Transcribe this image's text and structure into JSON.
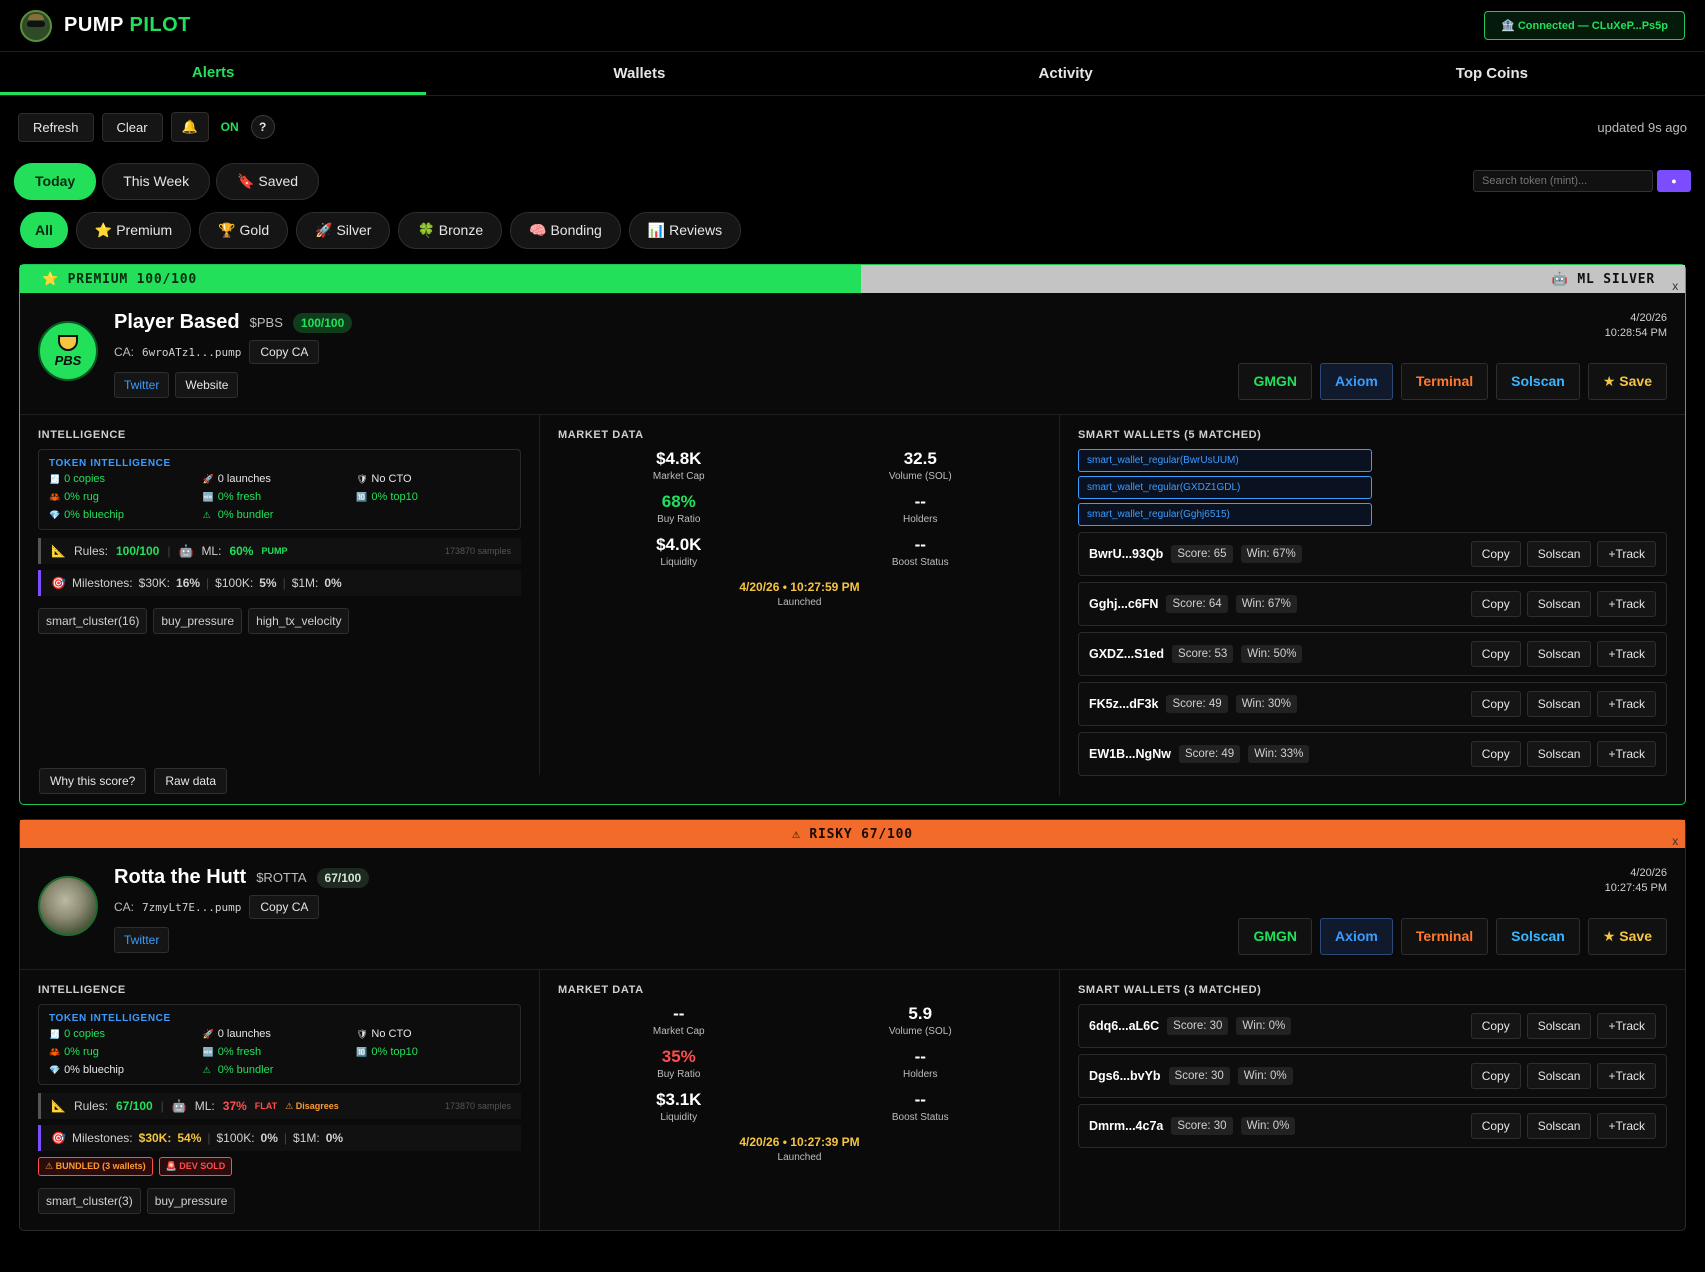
{
  "app": {
    "name_a": "PUMP",
    "name_b": "PILOT",
    "connection": "🏦 Connected — CLuXeP...Ps5p"
  },
  "nav": [
    {
      "label": "Alerts"
    },
    {
      "label": "Wallets"
    },
    {
      "label": "Activity"
    },
    {
      "label": "Top Coins"
    }
  ],
  "toolbar": {
    "refresh": "Refresh",
    "clear": "Clear",
    "bell": "🔔",
    "on": "ON",
    "help": "?",
    "updated": "updated 9s ago"
  },
  "periods": [
    {
      "label": "Today"
    },
    {
      "label": "This Week"
    },
    {
      "label": "🔖 Saved"
    }
  ],
  "search": {
    "placeholder": "Search token (mint)...",
    "go": "●"
  },
  "tiers": [
    {
      "label": "All"
    },
    {
      "label": "⭐ Premium"
    },
    {
      "label": "🏆 Gold"
    },
    {
      "label": "🚀 Silver"
    },
    {
      "label": "🍀 Bronze"
    },
    {
      "label": "🧠 Bonding"
    },
    {
      "label": "📊 Reviews"
    }
  ],
  "cards": [
    {
      "banner_left": "⭐ PREMIUM 100/100",
      "banner_right": "🤖 ML SILVER",
      "close": "x",
      "name": "Player Based",
      "ticker": "$PBS",
      "score": "100/100",
      "avatar_text": "PBS",
      "ca_label": "CA:",
      "ca": "6wroATz1...pump",
      "copy_ca": "Copy CA",
      "twitter": "Twitter",
      "website": "Website",
      "date": "4/20/26",
      "time": "10:28:54 PM",
      "ext": {
        "gmgn": "GMGN",
        "axiom": "Axiom",
        "terminal": "Terminal",
        "solscan": "Solscan",
        "save": "★ Save"
      },
      "intel_title": "INTELLIGENCE",
      "ti_title": "TOKEN INTELLIGENCE",
      "ti": [
        {
          "icon": "🧾",
          "text": "0 copies"
        },
        {
          "icon": "🚀",
          "text": "0 launches"
        },
        {
          "icon": "🛡",
          "text": "No CTO"
        },
        {
          "icon": "🦀",
          "text": "0% rug"
        },
        {
          "icon": "🆕",
          "text": "0% fresh"
        },
        {
          "icon": "🔟",
          "text": "0% top10"
        },
        {
          "icon": "💎",
          "text": "0% bluechip"
        },
        {
          "icon": "⚠",
          "text": "0% bundler"
        }
      ],
      "rules_label": "Rules:",
      "rules_val": "100/100",
      "ml_label": "ML:",
      "ml_val": "60%",
      "ml_tag": "PUMP",
      "ml_extra": "",
      "samples": "173870 samples",
      "ms_label": "Milestones:",
      "ms": [
        {
          "k": "$30K:",
          "v": "16%"
        },
        {
          "k": "$100K:",
          "v": "5%"
        },
        {
          "k": "$1M:",
          "v": "0%"
        }
      ],
      "tags": [
        "smart_cluster(16)",
        "buy_pressure",
        "high_tx_velocity"
      ],
      "md_title": "MARKET DATA",
      "md": [
        {
          "v": "$4.8K",
          "l": "Market Cap"
        },
        {
          "v": "32.5",
          "l": "Volume (SOL)"
        },
        {
          "v": "68%",
          "l": "Buy Ratio"
        },
        {
          "v": "--",
          "l": "Holders"
        },
        {
          "v": "$4.0K",
          "l": "Liquidity"
        },
        {
          "v": "--",
          "l": "Boost Status"
        }
      ],
      "launched": "4/20/26 • 10:27:59 PM",
      "launched_label": "Launched",
      "sw_title": "SMART WALLETS (5 MATCHED)",
      "sw_chips": [
        "smart_wallet_regular(BwrUsUUM)",
        "smart_wallet_regular(GXDZ1GDL)",
        "smart_wallet_regular(Gghj6515)"
      ],
      "wallets": [
        {
          "addr": "BwrU...93Qb",
          "score": "Score: 65",
          "win": "Win: 67%"
        },
        {
          "addr": "Gghj...c6FN",
          "score": "Score: 64",
          "win": "Win: 67%"
        },
        {
          "addr": "GXDZ...S1ed",
          "score": "Score: 53",
          "win": "Win: 50%"
        },
        {
          "addr": "FK5z...dF3k",
          "score": "Score: 49",
          "win": "Win: 30%"
        },
        {
          "addr": "EW1B...NgNw",
          "score": "Score: 49",
          "win": "Win: 33%"
        }
      ],
      "why": "Why this score?",
      "raw": "Raw data"
    },
    {
      "banner": "⚠ RISKY 67/100",
      "close": "x",
      "name": "Rotta the Hutt",
      "ticker": "$ROTTA",
      "score": "67/100",
      "ca_label": "CA:",
      "ca": "7zmyLt7E...pump",
      "copy_ca": "Copy CA",
      "twitter": "Twitter",
      "date": "4/20/26",
      "time": "10:27:45 PM",
      "ext": {
        "gmgn": "GMGN",
        "axiom": "Axiom",
        "terminal": "Terminal",
        "solscan": "Solscan",
        "save": "★ Save"
      },
      "intel_title": "INTELLIGENCE",
      "ti_title": "TOKEN INTELLIGENCE",
      "ti": [
        {
          "icon": "🧾",
          "text": "0 copies"
        },
        {
          "icon": "🚀",
          "text": "0 launches"
        },
        {
          "icon": "🛡",
          "text": "No CTO"
        },
        {
          "icon": "🦀",
          "text": "0% rug"
        },
        {
          "icon": "🆕",
          "text": "0% fresh"
        },
        {
          "icon": "🔟",
          "text": "0% top10"
        },
        {
          "icon": "💎",
          "text": "0% bluechip"
        },
        {
          "icon": "⚠",
          "text": "0% bundler"
        }
      ],
      "rules_label": "Rules:",
      "rules_val": "67/100",
      "ml_label": "ML:",
      "ml_val": "37%",
      "ml_tag": "FLAT",
      "ml_extra": "⚠ Disagrees",
      "samples": "173870 samples",
      "ms_label": "Milestones:",
      "ms": [
        {
          "k": "$30K:",
          "v": "54%"
        },
        {
          "k": "$100K:",
          "v": "0%"
        },
        {
          "k": "$1M:",
          "v": "0%"
        }
      ],
      "warns": [
        "⚠ BUNDLED (3 wallets)",
        "🚨 DEV SOLD"
      ],
      "tags": [
        "smart_cluster(3)",
        "buy_pressure"
      ],
      "md_title": "MARKET DATA",
      "md": [
        {
          "v": "--",
          "l": "Market Cap"
        },
        {
          "v": "5.9",
          "l": "Volume (SOL)"
        },
        {
          "v": "35%",
          "l": "Buy Ratio"
        },
        {
          "v": "--",
          "l": "Holders"
        },
        {
          "v": "$3.1K",
          "l": "Liquidity"
        },
        {
          "v": "--",
          "l": "Boost Status"
        }
      ],
      "launched": "4/20/26 • 10:27:39 PM",
      "launched_label": "Launched",
      "sw_title": "SMART WALLETS (3 MATCHED)",
      "wallets": [
        {
          "addr": "6dq6...aL6C",
          "score": "Score: 30",
          "win": "Win: 0%"
        },
        {
          "addr": "Dgs6...bvYb",
          "score": "Score: 30",
          "win": "Win: 0%"
        },
        {
          "addr": "Dmrm...4c7a",
          "score": "Score: 30",
          "win": "Win: 0%"
        }
      ]
    }
  ],
  "wallet_actions": {
    "copy": "Copy",
    "solscan": "Solscan",
    "track": "+Track"
  },
  "colors": {
    "accent": "#22e05a",
    "risky": "#f26b2a",
    "link": "#3b9cff",
    "gold": "#f5c542"
  }
}
